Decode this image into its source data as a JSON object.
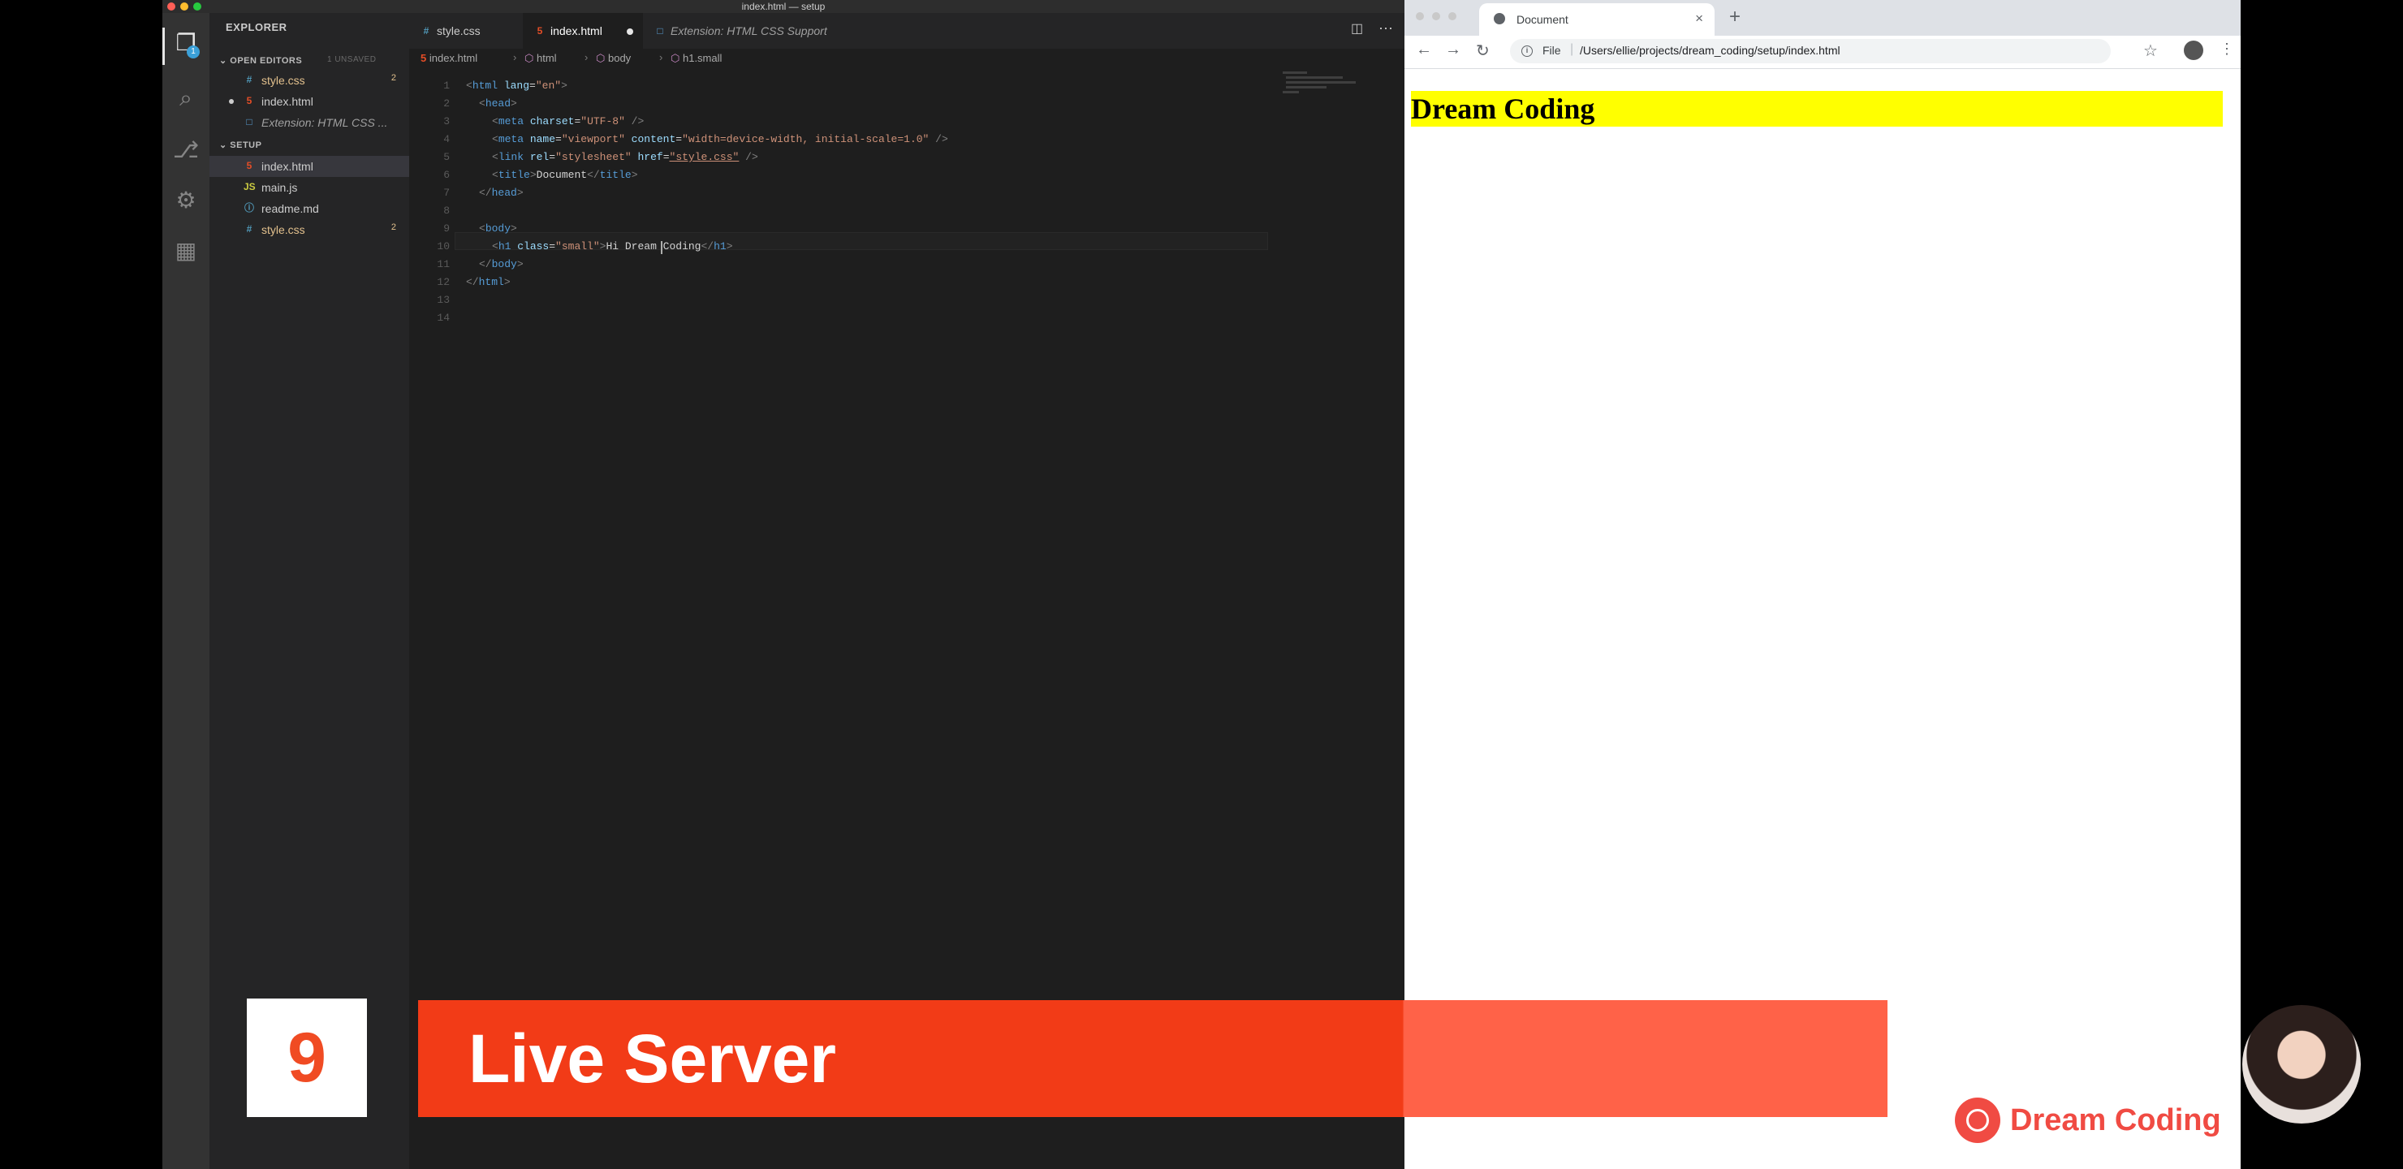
{
  "vscode": {
    "title": "index.html — setup",
    "explorer": {
      "title": "EXPLORER",
      "open_editors_label": "OPEN EDITORS",
      "unsaved_label": "1 UNSAVED",
      "open_editors": [
        {
          "name": "style.css",
          "badge": "2"
        },
        {
          "name": "index.html",
          "badge": ""
        },
        {
          "name": "Extension: HTML CSS ...",
          "badge": ""
        }
      ],
      "folder_label": "SETUP",
      "files": [
        {
          "name": "index.html",
          "badge": ""
        },
        {
          "name": "main.js",
          "badge": ""
        },
        {
          "name": "readme.md",
          "badge": ""
        },
        {
          "name": "style.css",
          "badge": "2"
        }
      ],
      "badge_count": "1"
    },
    "tabs": [
      {
        "label": "style.css"
      },
      {
        "label": "index.html"
      },
      {
        "label": "Extension: HTML CSS Support"
      }
    ],
    "breadcrumb": [
      "index.html",
      "html",
      "body",
      "h1.small"
    ],
    "line_numbers": [
      "1",
      "2",
      "3",
      "4",
      "5",
      "6",
      "7",
      "8",
      "9",
      "10",
      "11",
      "12",
      "13",
      "14"
    ],
    "code": {
      "l1": {
        "t1": "<",
        "tag": "html",
        "a": " lang",
        "eq": "=",
        "s": "\"en\"",
        "t2": ">"
      },
      "l2": {
        "t1": "<",
        "tag": "head",
        "t2": ">"
      },
      "l3": {
        "t1": "<",
        "tag": "meta",
        "a": " charset",
        "eq": "=",
        "s": "\"UTF-8\"",
        "t2": " />"
      },
      "l4": {
        "t1": "<",
        "tag": "meta",
        "a": " name",
        "eq": "=",
        "s": "\"viewport\"",
        "a2": " content",
        "eq2": "=",
        "s2": "\"width=device-width, initial-scale=1.0\"",
        "t2": " />"
      },
      "l5": {
        "t1": "<",
        "tag": "link",
        "a": " rel",
        "eq": "=",
        "s": "\"stylesheet\"",
        "a2": " href",
        "eq2": "=",
        "s2": "\"style.css\"",
        "t2": " />"
      },
      "l6": {
        "t1": "<",
        "tag": "title",
        "t2": ">",
        "text": "Document",
        "t3": "</",
        "tag2": "title",
        "t4": ">"
      },
      "l7": {
        "t1": "</",
        "tag": "head",
        "t2": ">"
      },
      "l9": {
        "t1": "<",
        "tag": "body",
        "t2": ">"
      },
      "l10": {
        "t1": "<",
        "tag": "h1",
        "a": " class",
        "eq": "=",
        "s": "\"small\"",
        "t2": ">",
        "text": "Hi Dream Coding",
        "t3": "</",
        "tag2": "h1",
        "t4": ">"
      },
      "l11": {
        "t1": "</",
        "tag": "body",
        "t2": ">"
      },
      "l12": {
        "t1": "</",
        "tag": "html",
        "t2": ">"
      }
    }
  },
  "chrome": {
    "tab_title": "Document",
    "close_glyph": "×",
    "new_tab_glyph": "+",
    "omnibox_scheme": "File",
    "omnibox_sep": "|",
    "url": "/Users/ellie/projects/dream_coding/setup/index.html",
    "page_heading": "Dream Coding"
  },
  "overlay": {
    "episode_number": "9",
    "banner_title": "Live Server",
    "brand_name": "Dream Coding"
  },
  "colors": {
    "accent": "#f23b17",
    "banner_light": "#ff6248",
    "brand": "#f04b43",
    "page_highlight": "#ffff00"
  }
}
